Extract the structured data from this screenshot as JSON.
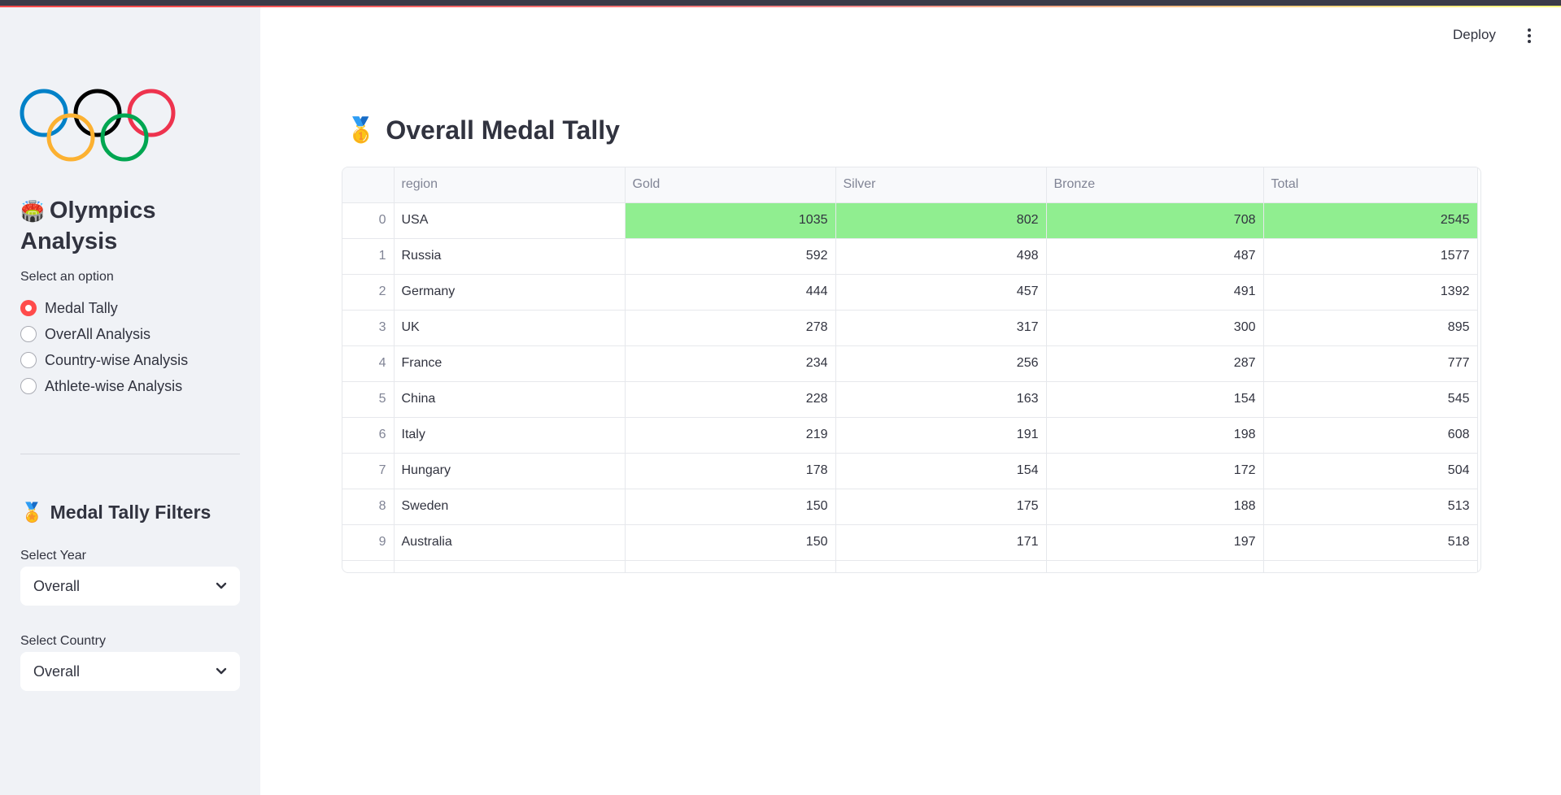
{
  "sidebar": {
    "title": "Olympics Analysis",
    "title_line1": "Olympics",
    "title_line2": "Analysis",
    "title_icon": "stadium-icon",
    "logo_icon": "olympic-rings-icon",
    "option_label": "Select an option",
    "options": [
      {
        "label": "Medal Tally",
        "selected": true
      },
      {
        "label": "OverAll Analysis",
        "selected": false
      },
      {
        "label": "Country-wise Analysis",
        "selected": false
      },
      {
        "label": "Athlete-wise Analysis",
        "selected": false
      }
    ],
    "filters_title": "Medal Tally Filters",
    "filters_icon": "medal-icon",
    "year_label": "Select Year",
    "year_value": "Overall",
    "country_label": "Select Country",
    "country_value": "Overall"
  },
  "header": {
    "deploy_label": "Deploy",
    "menu_icon": "more-vertical-icon"
  },
  "main": {
    "title": "Overall Medal Tally",
    "title_icon": "medal-icon",
    "highlight_color": "#90ee90",
    "table": {
      "columns": [
        "",
        "region",
        "Gold",
        "Silver",
        "Bronze",
        "Total"
      ],
      "rows": [
        {
          "index": "0",
          "region": "USA",
          "gold": "1035",
          "silver": "802",
          "bronze": "708",
          "total": "2545"
        },
        {
          "index": "1",
          "region": "Russia",
          "gold": "592",
          "silver": "498",
          "bronze": "487",
          "total": "1577"
        },
        {
          "index": "2",
          "region": "Germany",
          "gold": "444",
          "silver": "457",
          "bronze": "491",
          "total": "1392"
        },
        {
          "index": "3",
          "region": "UK",
          "gold": "278",
          "silver": "317",
          "bronze": "300",
          "total": "895"
        },
        {
          "index": "4",
          "region": "France",
          "gold": "234",
          "silver": "256",
          "bronze": "287",
          "total": "777"
        },
        {
          "index": "5",
          "region": "China",
          "gold": "228",
          "silver": "163",
          "bronze": "154",
          "total": "545"
        },
        {
          "index": "6",
          "region": "Italy",
          "gold": "219",
          "silver": "191",
          "bronze": "198",
          "total": "608"
        },
        {
          "index": "7",
          "region": "Hungary",
          "gold": "178",
          "silver": "154",
          "bronze": "172",
          "total": "504"
        },
        {
          "index": "8",
          "region": "Sweden",
          "gold": "150",
          "silver": "175",
          "bronze": "188",
          "total": "513"
        },
        {
          "index": "9",
          "region": "Australia",
          "gold": "150",
          "silver": "171",
          "bronze": "197",
          "total": "518"
        }
      ]
    }
  }
}
